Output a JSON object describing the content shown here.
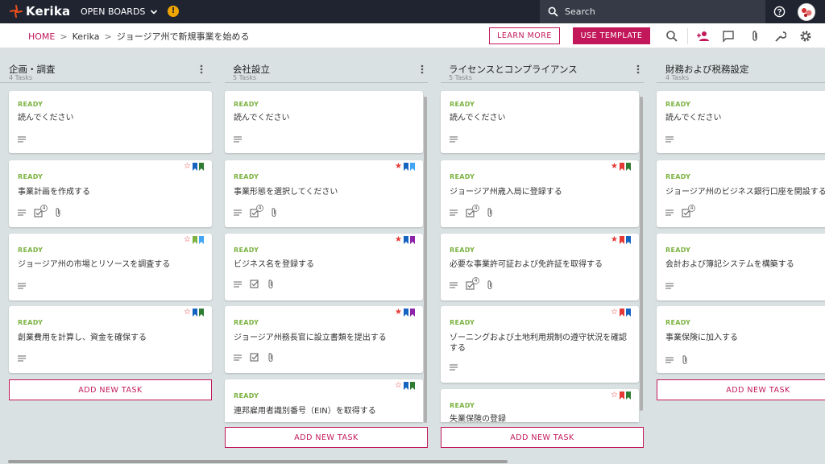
{
  "app": {
    "name": "Kerika",
    "open_boards": "OPEN BOARDS",
    "warning": "!"
  },
  "search": {
    "placeholder": "Search"
  },
  "breadcrumb": {
    "home": "HOME",
    "org": "Kerika",
    "board": "ジョージア州で新規事業を始める",
    "sep": ">"
  },
  "toolbar": {
    "learn_more": "LEARN MORE",
    "use_template": "USE TEMPLATE"
  },
  "colors": {
    "accent": "#c2185b",
    "ready": "#7cb342",
    "topbar": "#202431",
    "star_red": "#e53935",
    "flag_blue": "#1565c0",
    "flag_green": "#2e7d32",
    "flag_red": "#e53935",
    "flag_purple": "#8e24aa",
    "flag_lightblue": "#42a5f5",
    "flag_lightgreen": "#7cb342"
  },
  "add_task_label": "ADD NEW TASK",
  "columns": [
    {
      "title": "企画・調査",
      "count": "4 Tasks",
      "cards": [
        {
          "status": "READY",
          "title": "読んでください"
        },
        {
          "status": "READY",
          "title": "事業計画を作成する",
          "checklist": "4"
        },
        {
          "status": "READY",
          "title": "ジョージア州の市場とリソースを調査する"
        },
        {
          "status": "READY",
          "title": "創業費用を計算し、資金を確保する"
        }
      ]
    },
    {
      "title": "会社設立",
      "count": "5 Tasks",
      "cards": [
        {
          "status": "READY",
          "title": "読んでください"
        },
        {
          "status": "READY",
          "title": "事業形態を選択してください",
          "checklist": "4"
        },
        {
          "status": "READY",
          "title": "ビジネス名を登録する"
        },
        {
          "status": "READY",
          "title": "ジョージア州務長官に設立書類を提出する"
        },
        {
          "status": "READY",
          "title": "連邦雇用者識別番号（EIN）を取得する"
        }
      ]
    },
    {
      "title": "ライセンスとコンプライアンス",
      "count": "5 Tasks",
      "cards": [
        {
          "status": "READY",
          "title": "読んでください"
        },
        {
          "status": "READY",
          "title": "ジョージア州歳入局に登録する",
          "checklist": "4"
        },
        {
          "status": "READY",
          "title": "必要な事業許可証および免許証を取得する",
          "checklist": "4"
        },
        {
          "status": "READY",
          "title": "ゾーニングおよび土地利用規制の遵守状況を確認する"
        },
        {
          "status": "READY",
          "title": "失業保険の登録"
        }
      ]
    },
    {
      "title": "財務および税務設定",
      "count": "4 Tasks",
      "cards": [
        {
          "status": "READY",
          "title": "読んでください"
        },
        {
          "status": "READY",
          "title": "ジョージア州のビジネス銀行口座を開設する",
          "checklist": "4"
        },
        {
          "status": "READY",
          "title": "会計および簿記システムを構築する"
        },
        {
          "status": "READY",
          "title": "事業保険に加入する"
        }
      ]
    }
  ]
}
